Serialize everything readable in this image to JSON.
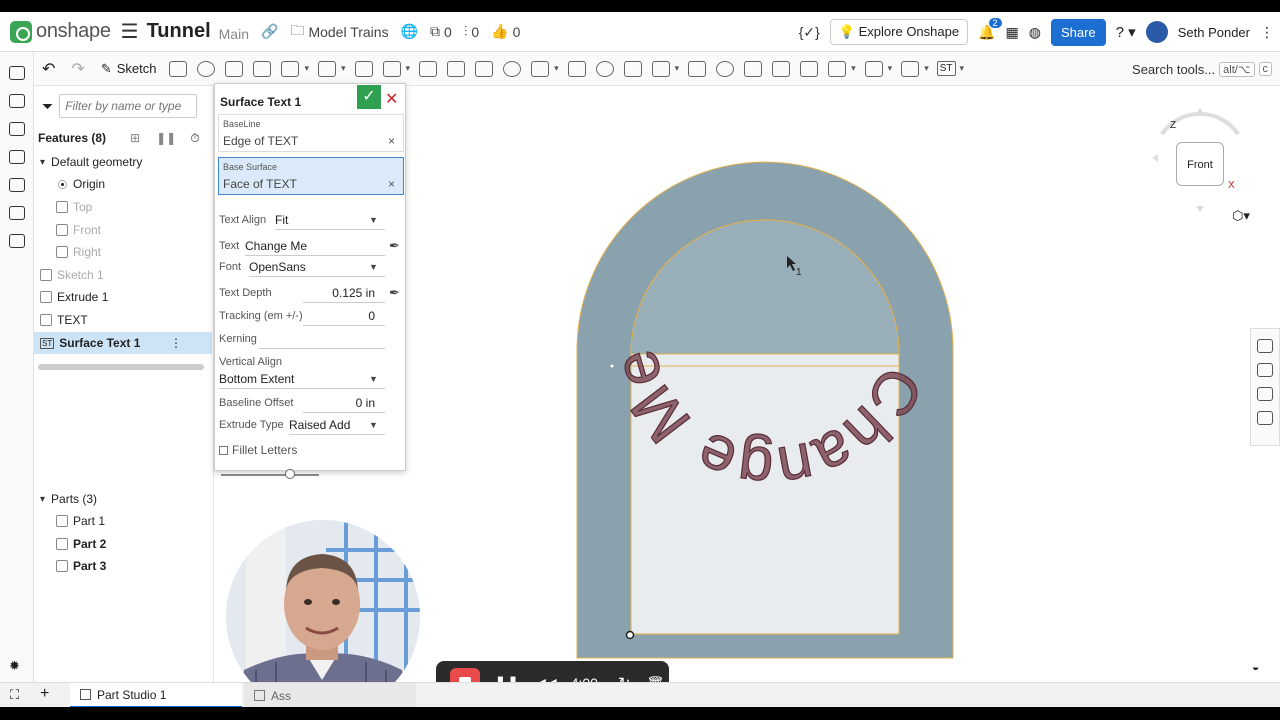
{
  "header": {
    "logo": "onshape",
    "doc_title": "Tunnel",
    "branch": "Main",
    "folder": "Model Trains",
    "count_a": "0",
    "count_b": "0",
    "count_c": "0",
    "explore": "Explore Onshape",
    "notif_count": "2",
    "share": "Share",
    "user": "Seth Ponder"
  },
  "toolbar": {
    "sketch": "Sketch",
    "search_label": "Search tools...",
    "shortcut_1": "alt/⌥",
    "shortcut_2": "c",
    "st_label": "ST"
  },
  "tree": {
    "filter_placeholder": "Filter by name or type",
    "features_label": "Features (8)",
    "default_geometry": "Default geometry",
    "items": [
      {
        "label": "Origin"
      },
      {
        "label": "Top"
      },
      {
        "label": "Front"
      },
      {
        "label": "Right"
      },
      {
        "label": "Sketch 1"
      },
      {
        "label": "Extrude 1"
      },
      {
        "label": "TEXT"
      },
      {
        "label": "Surface Text 1"
      }
    ],
    "parts_label": "Parts (3)",
    "parts": [
      {
        "label": "Part 1"
      },
      {
        "label": "Part 2"
      },
      {
        "label": "Part 3"
      }
    ]
  },
  "dialog": {
    "title": "Surface Text 1",
    "baseline_label": "BaseLine",
    "baseline_value": "Edge of TEXT",
    "base_surface_label": "Base Surface",
    "base_surface_value": "Face of TEXT",
    "text_align_label": "Text Align",
    "text_align_value": "Fit",
    "text_label": "Text",
    "text_value": "Change Me",
    "font_label": "Font",
    "font_value": "OpenSans",
    "text_depth_label": "Text Depth",
    "text_depth_value": "0.125 in",
    "tracking_label": "Tracking (em +/-)",
    "tracking_value": "0",
    "kerning_label": "Kerning",
    "vertical_align_label": "Vertical Align",
    "vertical_align_value": "Bottom Extent",
    "baseline_offset_label": "Baseline Offset",
    "baseline_offset_value": "0 in",
    "extrude_type_label": "Extrude Type",
    "extrude_type_value": "Raised Add",
    "fillet_label": "Fillet Letters",
    "slider_level": 0.7
  },
  "viewport": {
    "arc_text": "Change Me",
    "cursor_tag": "1",
    "cube_face": "Front",
    "axis_z": "Z",
    "axis_x": "X",
    "colors": {
      "arch": "#8aa2ae",
      "letters": "#7c4a55",
      "letters_alt": "#9a5a3d",
      "inner": "#e9ecef",
      "edge": "#e2b04d"
    }
  },
  "recorder": {
    "time": "4:00"
  },
  "tabs": [
    {
      "label": "Part Studio 1"
    },
    {
      "label": "Ass"
    }
  ]
}
